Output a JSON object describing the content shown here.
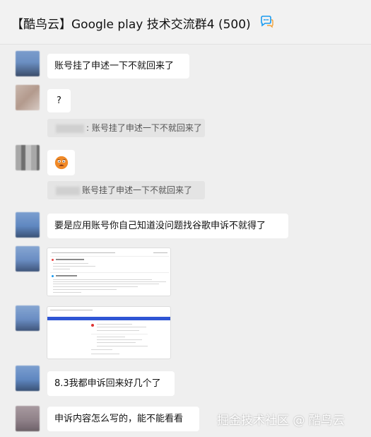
{
  "header": {
    "title": "【酷鸟云】Google play 技术交流群4 (500)",
    "icon": "chat-bubbles-icon"
  },
  "messages": [
    {
      "text": "账号挂了申述一下不就回来了"
    },
    {
      "text": "?"
    },
    {
      "quote": ": 账号挂了申述一下不就回来了"
    },
    {
      "emoji": "crying-face-emoji"
    },
    {
      "quote": "账号挂了申述一下不就回来了"
    },
    {
      "text": "要是应用账号你自己知道没问题找谷歌申诉不就得了"
    },
    {
      "image": "email-screenshot"
    },
    {
      "image": "appeal-page-screenshot"
    },
    {
      "text": "8.3我都申诉回来好几个了"
    },
    {
      "text": "申诉内容怎么写的，能不能看看"
    }
  ],
  "watermark": "掘金技术社区 @ 酷鸟云",
  "colors": {
    "background": "#efefef",
    "bubble": "#ffffff",
    "quote": "#e4e4e4",
    "icon_blue": "#1a9bf0",
    "banner_blue": "#2f55d4"
  }
}
